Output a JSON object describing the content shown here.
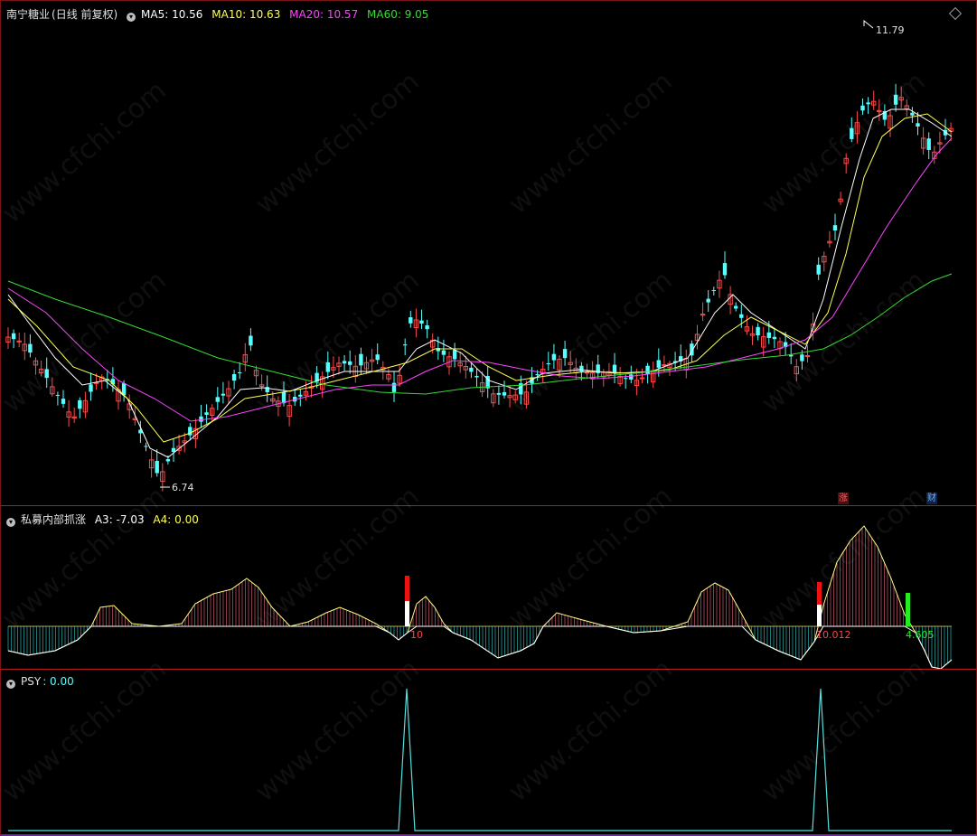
{
  "main_panel": {
    "stock_name": "南宁糖业",
    "period": "(日线 前复权)",
    "ma5_label": "MA5: 10.56",
    "ma10_label": "MA10: 10.63",
    "ma20_label": "MA20: 10.57",
    "ma60_label": "MA60: 9.05",
    "high_marker": "11.79",
    "low_marker": "6.74",
    "badge_rise": "涨",
    "badge_finance": "财",
    "colors": {
      "ma5": "#ffffff",
      "ma10": "#ffff55",
      "ma20": "#ff44ff",
      "ma60": "#33dd33",
      "up": "#ff4a4a",
      "down": "#55ffff"
    }
  },
  "indicator_panel": {
    "name": "私募内部抓涨",
    "a3_label": "A3: -7.03",
    "a4_label": "A4: 0.00",
    "mark1": "10",
    "mark2": "10.012",
    "mark3": "4.605"
  },
  "psy_panel": {
    "name": "PSY",
    "value_label": ": 0.00"
  },
  "watermark": "www.cfchi.com",
  "chart_data": [
    {
      "type": "line",
      "title": "南宁糖业 (日线 前复权)",
      "price_range": [
        6.74,
        11.79
      ],
      "series": [
        {
          "name": "MA5",
          "last": 10.56
        },
        {
          "name": "MA10",
          "last": 10.63
        },
        {
          "name": "MA20",
          "last": 10.57
        },
        {
          "name": "MA60",
          "last": 9.05
        }
      ],
      "annotations": [
        "11.79",
        "6.74"
      ]
    },
    {
      "type": "area",
      "title": "私募内部抓涨",
      "series": [
        {
          "name": "A3",
          "last": -7.03
        },
        {
          "name": "A4",
          "last": 0.0
        }
      ],
      "annotations": [
        "10",
        "10.012",
        "4.605"
      ]
    },
    {
      "type": "line",
      "title": "PSY",
      "series": [
        {
          "name": "PSY",
          "last": 0.0
        }
      ]
    }
  ]
}
